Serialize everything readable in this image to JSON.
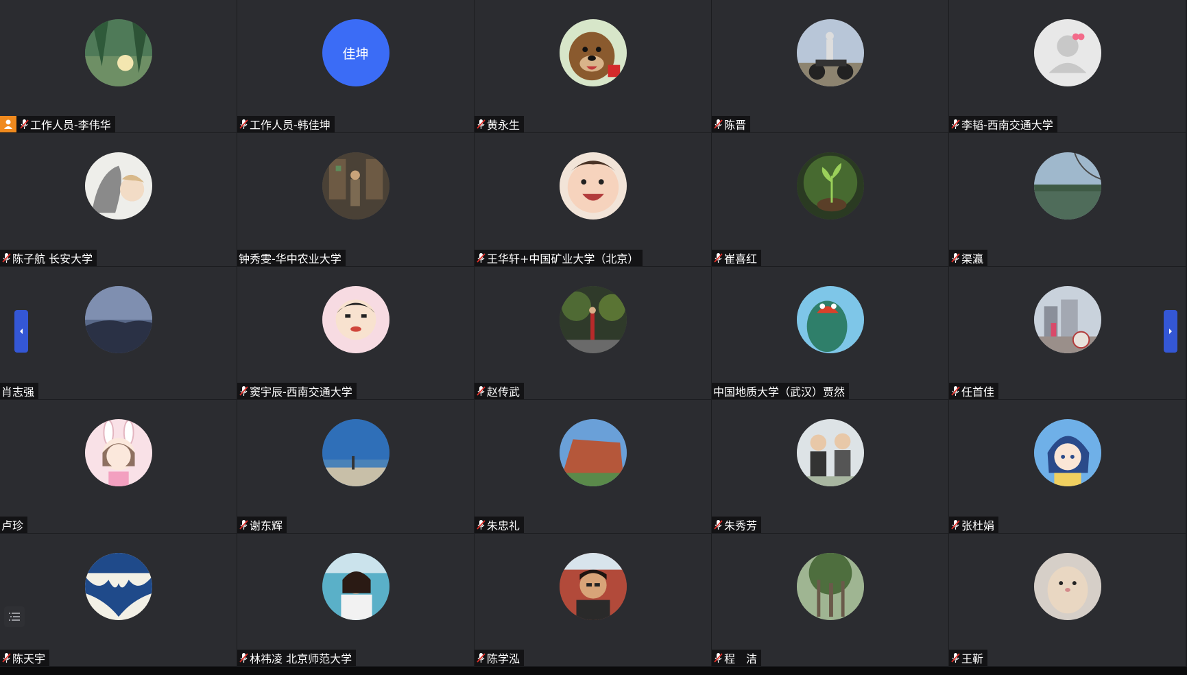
{
  "participants": [
    {
      "name": "工作人员-李伟华",
      "host": true,
      "mic": true,
      "avatar": "forest-sun"
    },
    {
      "name": "工作人员-韩佳坤",
      "mic": true,
      "avatar_text": "佳坤"
    },
    {
      "name": "黄永生",
      "mic": true,
      "avatar": "cartoon-bear"
    },
    {
      "name": "陈晋",
      "mic": true,
      "avatar": "motorcycle-rider"
    },
    {
      "name": "李韬-西南交通大学",
      "mic": true,
      "avatar": "default-user"
    },
    {
      "name": "陈子航 长安大学",
      "mic": true,
      "avatar": "anime-cat-girl"
    },
    {
      "name": "钟秀雯-华中农业大学",
      "mic": false,
      "avatar": "shop-interior"
    },
    {
      "name": "王华轩+中国矿业大学（北京）",
      "mic": true,
      "avatar": "laughing-baby"
    },
    {
      "name": "崔喜红",
      "mic": true,
      "avatar": "green-sprout"
    },
    {
      "name": "渠瀛",
      "mic": true,
      "avatar": "lake-tree"
    },
    {
      "name": "肖志强",
      "mic": false,
      "avatar": "misty-mountain"
    },
    {
      "name": "窦宇辰-西南交通大学",
      "mic": true,
      "avatar": "crayon-shin-chan"
    },
    {
      "name": "赵传武",
      "mic": true,
      "avatar": "night-street"
    },
    {
      "name": "中国地质大学（武汉）贾然",
      "mic": false,
      "avatar": "green-dinosaur"
    },
    {
      "name": "任首佳",
      "mic": true,
      "avatar": "building-photo"
    },
    {
      "name": "卢珍",
      "mic": false,
      "avatar": "bunny-girl"
    },
    {
      "name": "谢东辉",
      "mic": true,
      "avatar": "beach-sky"
    },
    {
      "name": "朱忠礼",
      "mic": true,
      "avatar": "brick-fortress"
    },
    {
      "name": "朱秀芳",
      "mic": true,
      "avatar": "two-kids"
    },
    {
      "name": "张杜娟",
      "mic": true,
      "avatar": "anime-blue-hair"
    },
    {
      "name": "陈天宇",
      "mic": true,
      "avatar": "bat-logo"
    },
    {
      "name": "林祎凌 北京师范大学",
      "mic": true,
      "avatar": "woman-beach"
    },
    {
      "name": "陈学泓",
      "mic": true,
      "avatar": "young-man"
    },
    {
      "name": "程　洁",
      "mic": true,
      "avatar": "banyan-tree"
    },
    {
      "name": "王靳",
      "mic": true,
      "avatar": "hamster"
    }
  ],
  "colors": {
    "tile_bg": "#2b2c30",
    "accent_blue": "#3457d5",
    "host_orange": "#f08a1e",
    "mic_red": "#e0302a"
  },
  "icons": {
    "mic": "microphone-muted-icon",
    "host": "host-user-icon",
    "nav_left": "chevron-left-icon",
    "nav_right": "chevron-right-icon",
    "list": "list-icon"
  }
}
